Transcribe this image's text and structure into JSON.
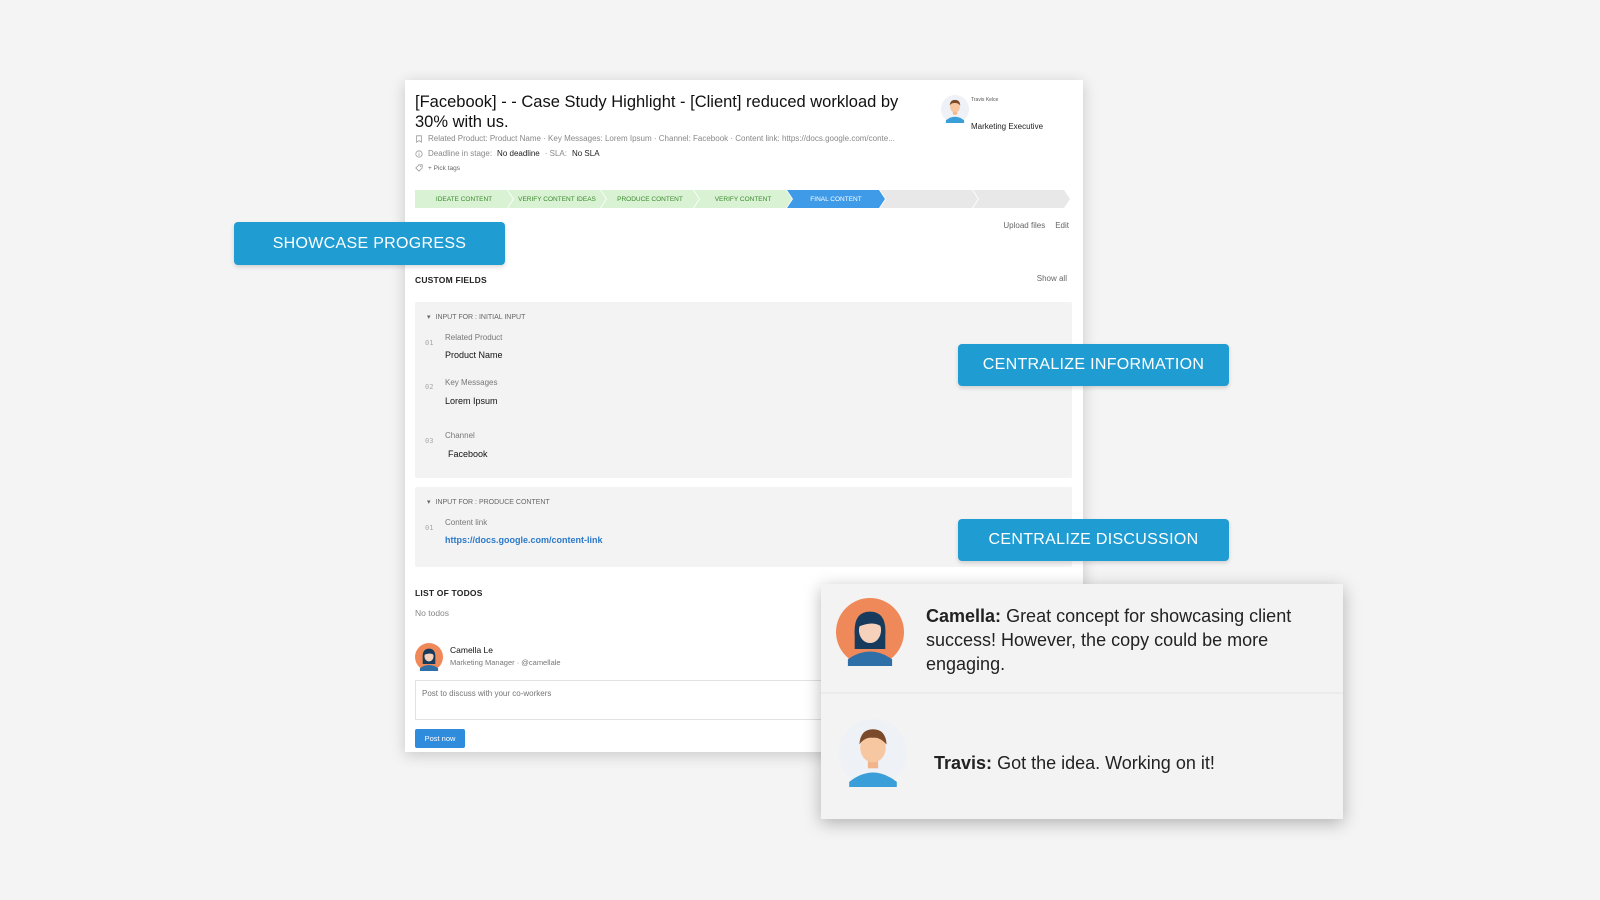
{
  "task": {
    "title": "[Facebook] - - Case Study Highlight - [Client] reduced workload by 30% with us.",
    "meta_summary": "Related Product: Product Name · Key Messages: Lorem Ipsum · Channel: Facebook · Content link: https://docs.google.com/conte...",
    "deadline_label": "Deadline in stage:",
    "deadline_value": "No deadline",
    "sla_label": "· SLA:",
    "sla_value": "No SLA",
    "pick_tags": "Pick tags"
  },
  "assignee": {
    "name": "Travis Kelce",
    "role": "Marketing Executive"
  },
  "stages": [
    {
      "label": "IDEATE CONTENT",
      "state": "done"
    },
    {
      "label": "VERIFY CONTENT IDEAS",
      "state": "done"
    },
    {
      "label": "PRODUCE CONTENT",
      "state": "done"
    },
    {
      "label": "VERIFY CONTENT",
      "state": "done"
    },
    {
      "label": "FINAL CONTENT",
      "state": "active"
    },
    {
      "label": "",
      "state": "empty"
    },
    {
      "label": "",
      "state": "empty"
    }
  ],
  "actions": {
    "upload": "Upload files",
    "edit": "Edit"
  },
  "custom_fields": {
    "title": "CUSTOM FIELDS",
    "show_all": "Show all",
    "groups": [
      {
        "title": "INPUT FOR : INITIAL INPUT",
        "fields": [
          {
            "num": "01",
            "label": "Related Product",
            "value": "Product Name"
          },
          {
            "num": "02",
            "label": "Key Messages",
            "value": "Lorem Ipsum"
          },
          {
            "num": "03",
            "label": "Channel",
            "value": "Facebook"
          }
        ]
      },
      {
        "title": "INPUT FOR : PRODUCE CONTENT",
        "fields": [
          {
            "num": "01",
            "label": "Content link",
            "value": "https://docs.google.com/content-link"
          }
        ]
      }
    ]
  },
  "todos": {
    "title": "LIST OF TODOS",
    "empty": "No todos"
  },
  "commenter": {
    "name": "Camella Le",
    "role": "Marketing Manager · @camellale"
  },
  "comment_box": {
    "placeholder": "Post to discuss with your co-workers",
    "button": "Post now"
  },
  "callouts": {
    "progress": "SHOWCASE PROGRESS",
    "information": "CENTRALIZE INFORMATION",
    "discussion": "CENTRALIZE DISCUSSION"
  },
  "messages": [
    {
      "author": "Camella:",
      "text": "Great concept for showcasing client success! However, the copy could be more engaging."
    },
    {
      "author": "Travis:",
      "text": "Got the idea. Working on it!"
    }
  ],
  "colors": {
    "accent": "#1f9dd3",
    "stage_done": "#d9f2d3",
    "stage_active": "#3f9be8",
    "link": "#2b79c9"
  }
}
